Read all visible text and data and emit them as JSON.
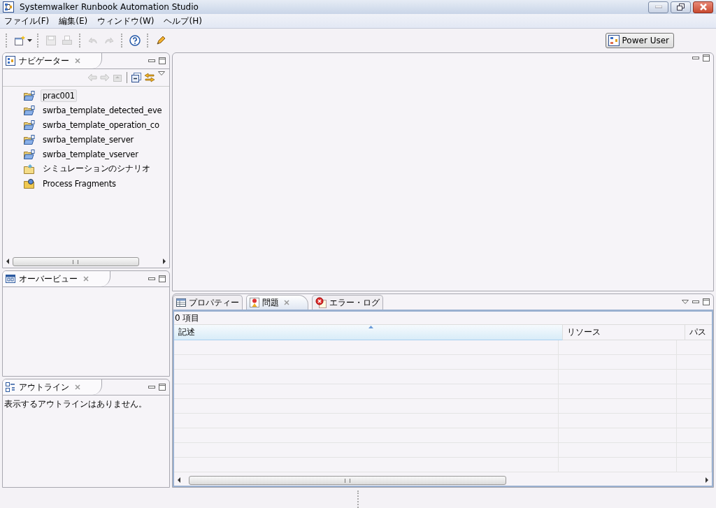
{
  "window": {
    "title": "Systemwalker Runbook Automation Studio"
  },
  "menu": [
    "ファイル(F)",
    "編集(E)",
    "ウィンドウ(W)",
    "ヘルプ(H)"
  ],
  "toolbar": [
    [
      {
        "kind": "new",
        "disabled": false
      }
    ],
    [
      {
        "kind": "save",
        "disabled": true
      },
      {
        "kind": "print",
        "disabled": true
      }
    ],
    [
      {
        "kind": "undo",
        "disabled": true
      },
      {
        "kind": "redo",
        "disabled": true
      }
    ],
    [
      {
        "kind": "help",
        "disabled": false
      }
    ],
    [
      {
        "kind": "launch",
        "disabled": false
      }
    ]
  ],
  "perspective": {
    "label": "Power User"
  },
  "navigator": {
    "title": "ナビゲーター",
    "tools": [
      {
        "kind": "back",
        "disabled": true
      },
      {
        "kind": "forward",
        "disabled": true
      },
      {
        "kind": "up",
        "disabled": true
      },
      {
        "kind": "collapse",
        "disabled": false
      },
      {
        "kind": "link",
        "disabled": false
      }
    ],
    "items": [
      {
        "label": "prac001",
        "kind": "project",
        "selected": true
      },
      {
        "label": "swrba_template_detected_eve",
        "kind": "project",
        "selected": false
      },
      {
        "label": "swrba_template_operation_co",
        "kind": "project",
        "selected": false
      },
      {
        "label": "swrba_template_server",
        "kind": "project",
        "selected": false
      },
      {
        "label": "swrba_template_vserver",
        "kind": "project",
        "selected": false
      },
      {
        "label": "シミュレーションのシナリオ",
        "kind": "scenario",
        "selected": false
      },
      {
        "label": "Process Fragments",
        "kind": "fragments",
        "selected": false
      }
    ]
  },
  "overview": {
    "title": "オーバービュー"
  },
  "outline": {
    "title": "アウトライン",
    "message": "表示するアウトラインはありません。"
  },
  "bottom_tabs": [
    {
      "label": "プロパティー",
      "kind": "properties",
      "selected": false
    },
    {
      "label": "問題",
      "kind": "problems",
      "selected": true
    },
    {
      "label": "エラー・ログ",
      "kind": "errorlog",
      "selected": false
    }
  ],
  "problems": {
    "count": "0 項目",
    "columns": [
      {
        "label": "記述",
        "sorted": true
      },
      {
        "label": "リソース",
        "sorted": false
      },
      {
        "label": "パス",
        "sorted": false
      }
    ]
  }
}
